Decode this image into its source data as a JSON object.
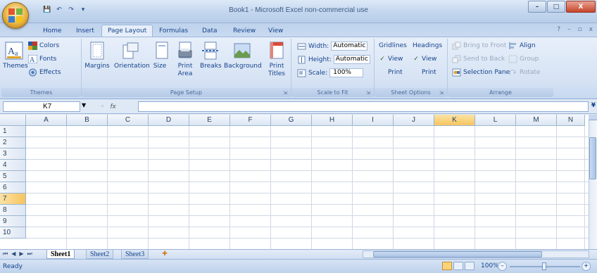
{
  "window": {
    "title": "Book1 - Microsoft Excel non-commercial use",
    "minimize": "–",
    "maximize": "□",
    "close": "X"
  },
  "quick_access": [
    "💾",
    "↶",
    "↷",
    "▾"
  ],
  "tabs": [
    "Home",
    "Insert",
    "Page Layout",
    "Formulas",
    "Data",
    "Review",
    "View"
  ],
  "active_tab": "Page Layout",
  "tab_right": {
    "help": "?",
    "min": "–",
    "restore": "▫",
    "close": "x"
  },
  "ribbon": {
    "themes": {
      "group_label": "Themes",
      "themes_label": "Themes",
      "colors_label": "Colors",
      "fonts_label": "Fonts",
      "effects_label": "Effects"
    },
    "page_setup": {
      "group_label": "Page Setup",
      "margins": "Margins",
      "orientation": "Orientation",
      "size": "Size",
      "print_area_1": "Print",
      "print_area_2": "Area",
      "breaks": "Breaks",
      "background": "Background",
      "print_titles_1": "Print",
      "print_titles_2": "Titles"
    },
    "scale_to_fit": {
      "group_label": "Scale to Fit",
      "width_label": "Width:",
      "width_value": "Automatic",
      "height_label": "Height:",
      "height_value": "Automatic",
      "scale_label": "Scale:",
      "scale_value": "100%"
    },
    "sheet_options": {
      "group_label": "Sheet Options",
      "gridlines": "Gridlines",
      "headings": "Headings",
      "view": "View",
      "print": "Print"
    },
    "arrange": {
      "group_label": "Arrange",
      "bring_to_front": "Bring to Front",
      "send_to_back": "Send to Back",
      "selection_pane": "Selection Pane",
      "align": "Align",
      "group": "Group",
      "rotate": "Rotate"
    }
  },
  "formula_bar": {
    "name_box": "K7",
    "fx": "fx",
    "formula": ""
  },
  "columns": [
    "A",
    "B",
    "C",
    "D",
    "E",
    "F",
    "G",
    "H",
    "I",
    "J",
    "K",
    "L",
    "M",
    "N"
  ],
  "rows": [
    "1",
    "2",
    "3",
    "4",
    "5",
    "6",
    "7",
    "8",
    "9",
    "10"
  ],
  "selected_cell": {
    "column": "K",
    "row": "7"
  },
  "sheets": [
    "Sheet1",
    "Sheet2",
    "Sheet3"
  ],
  "active_sheet": "Sheet1",
  "status": {
    "text": "Ready",
    "zoom": "100%",
    "zoom_minus": "–",
    "zoom_plus": "+"
  },
  "colors": {
    "ribbon_text": "#15428b",
    "selected_header": "#f7c45f",
    "grid_line": "#d0d7e5"
  }
}
